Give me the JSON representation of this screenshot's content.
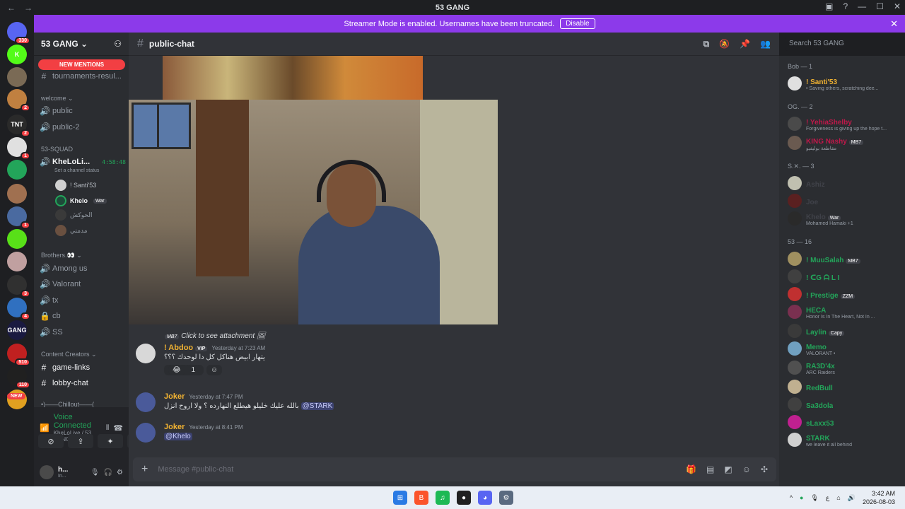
{
  "window": {
    "title": "53 GANG",
    "nav_back": "←",
    "nav_forward": "→"
  },
  "banner": {
    "text": "Streamer Mode is enabled. Usernames have been truncated.",
    "button": "Disable",
    "close": "✕"
  },
  "servers": [
    {
      "label": "",
      "badge": "330",
      "color": "#5865f2"
    },
    {
      "label": "K",
      "badge": "",
      "color": "#53fc18"
    },
    {
      "label": "",
      "badge": "",
      "color": "#7a6a55"
    },
    {
      "label": "",
      "badge": "2",
      "color": "#c08040"
    },
    {
      "label": "TNT",
      "badge": "2",
      "color": "#2a2a2a"
    },
    {
      "label": "",
      "badge": "1",
      "color": "#e0e0e0"
    },
    {
      "label": "",
      "badge": "",
      "color": "#23a55a"
    },
    {
      "label": "",
      "badge": "",
      "color": "#a07050"
    },
    {
      "label": "",
      "badge": "1",
      "color": "#4a6aa0"
    },
    {
      "label": "",
      "badge": "",
      "color": "#58e018"
    },
    {
      "label": "",
      "badge": "",
      "color": "#c0a0a0"
    },
    {
      "label": "",
      "badge": "3",
      "color": "#303030"
    },
    {
      "label": "",
      "badge": "4",
      "color": "#3070c0"
    },
    {
      "label": "GANG",
      "badge": "",
      "color": "#1a1a40"
    },
    {
      "label": "",
      "badge": "510",
      "color": "#c02020"
    },
    {
      "label": "",
      "badge": "110",
      "color": "#202020"
    },
    {
      "label": "",
      "badge": "",
      "color": "#e0a020"
    }
  ],
  "new_badge": "NEW",
  "sidebar": {
    "guild_name": "53 GANG",
    "new_mentions": "NEW MENTIONS",
    "channels_top": [
      {
        "label": "tournaments-resul...",
        "icon": "#"
      }
    ],
    "cat_welcome": "welcome",
    "welcome": [
      {
        "label": "public",
        "icon": "🔊"
      },
      {
        "label": "public-2",
        "icon": "🔊"
      }
    ],
    "cat_squad": "53-SQUAD",
    "voice_channel": {
      "label": "KheLoLi...",
      "timer": "4:58:48",
      "status": "Set a channel status"
    },
    "voice_users": [
      {
        "name": "! Santi'53",
        "tag": ""
      },
      {
        "name": "Khelo",
        "tag": "War"
      },
      {
        "name": "الحوكش",
        "tag": ""
      },
      {
        "name": "مدمني",
        "tag": ""
      }
    ],
    "cat_brothers": "Brothers.👀",
    "brothers": [
      {
        "label": "Among us",
        "icon": "🔊"
      },
      {
        "label": "Valorant",
        "icon": "🔊"
      },
      {
        "label": "tx",
        "icon": "🔊"
      },
      {
        "label": "cb",
        "icon": "🔒"
      },
      {
        "label": "SS",
        "icon": "🔊"
      }
    ],
    "cat_creators": "Content Creators",
    "creators": [
      {
        "label": "game-links",
        "icon": "#"
      },
      {
        "label": "lobby-chat",
        "icon": "#"
      }
    ],
    "cat_chillout": "•)——Chillout——("
  },
  "voice_panel": {
    "status": "Voice Connected",
    "location": "KheLoLive / 53 GANG",
    "user": "h...",
    "user_status": "In..."
  },
  "channel": {
    "name": "public-chat",
    "search_placeholder": "Search 53 GANG",
    "composer_placeholder": "Message #public-chat"
  },
  "messages": [
    {
      "reply": "Click to see attachment",
      "reply_tag": "MB7",
      "author": "! Abdoo",
      "author_tag": "VIP",
      "author_color": "#f0b232",
      "time": "Yesterday at 7:23 AM",
      "text": "يتهار ابيض هناكل كل دا لوحدك ؟؟؟",
      "reaction_emoji": "😂",
      "reaction_count": "1"
    },
    {
      "author": "Joker",
      "author_color": "#f0b232",
      "time": "Yesterday at 7:47 PM",
      "text": "بالله عليك خليلو هيطلع النهارده ؟ ولا اروح انزل",
      "mention": "@STARK"
    },
    {
      "author": "Joker",
      "author_color": "#f0b232",
      "time": "Yesterday at 8:41 PM",
      "text": "",
      "mention": "@Khelo"
    }
  ],
  "members": {
    "groups": [
      {
        "title": "Bob — 1",
        "items": [
          {
            "name": "! Santi'53",
            "color": "#f0b232",
            "status": "• Saving others, scratching dee...",
            "tag": ""
          }
        ]
      },
      {
        "title": "OG. — 2",
        "items": [
          {
            "name": "! YehiaShelby",
            "color": "#c0184a",
            "status": "Forgiveness is giving up the hope t...",
            "tag": ""
          },
          {
            "name": "KING Nashy",
            "color": "#c0184a",
            "status": "مقاطعة بوليفيو",
            "tag": "MB7"
          }
        ]
      },
      {
        "title": "S.✕. — 3",
        "items": [
          {
            "name": "Ashiz",
            "color": "#404249",
            "status": "",
            "tag": ""
          },
          {
            "name": "Joe",
            "color": "#404249",
            "status": "",
            "tag": ""
          },
          {
            "name": "Khelo",
            "color": "#404249",
            "status": "Mohamed Hamaki +1",
            "tag": "War"
          }
        ]
      },
      {
        "title": "53 — 16",
        "items": [
          {
            "name": "! MuuSalah",
            "color": "#23a55a",
            "status": "",
            "tag": "MB7"
          },
          {
            "name": "! ᑕG ᗩ L I",
            "color": "#23a55a",
            "status": "",
            "tag": ""
          },
          {
            "name": "! Prestige",
            "color": "#23a55a",
            "status": "",
            "tag": "ᏃᏃᎷ"
          },
          {
            "name": "HECA",
            "color": "#23a55a",
            "status": "Honor Is In The Heart, Not In ...",
            "tag": ""
          },
          {
            "name": "Laylin",
            "color": "#23a55a",
            "status": "",
            "tag": "Capy"
          },
          {
            "name": "Memo",
            "color": "#23a55a",
            "status": "VALORANT •",
            "tag": ""
          },
          {
            "name": "RA3D'4x",
            "color": "#23a55a",
            "status": "ARC Raiders",
            "tag": ""
          },
          {
            "name": "RedBull",
            "color": "#23a55a",
            "status": "",
            "tag": ""
          },
          {
            "name": "Sa3dola",
            "color": "#23a55a",
            "status": "",
            "tag": ""
          },
          {
            "name": "sLaxx53",
            "color": "#23a55a",
            "status": "",
            "tag": ""
          },
          {
            "name": "STARK",
            "color": "#23a55a",
            "status": "we leave it all behind",
            "tag": ""
          }
        ]
      }
    ]
  },
  "taskbar": {
    "time": "3:42 AM",
    "date": "2026-08-03",
    "lang": "ع"
  }
}
